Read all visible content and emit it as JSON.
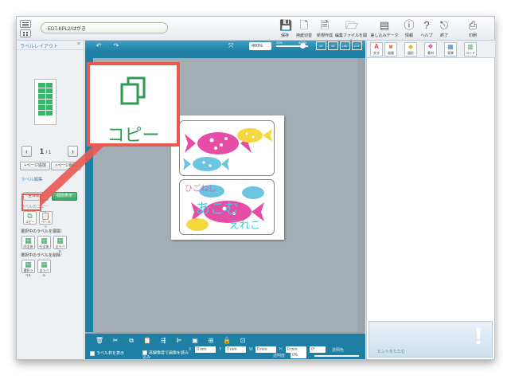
{
  "window": {
    "title": "EDT-KPL2/はがき"
  },
  "toolbar": [
    {
      "name": "save",
      "label": "保存",
      "icon": "save-icon"
    },
    {
      "name": "print-preview",
      "label": "用紙切替",
      "icon": "page-icon"
    },
    {
      "name": "new",
      "label": "新規作成",
      "icon": "new-file-icon"
    },
    {
      "name": "open",
      "label": "編集ファイルを開く",
      "icon": "folder-icon"
    },
    {
      "name": "data",
      "label": "差し込みデータ",
      "icon": "data-icon"
    },
    {
      "name": "info",
      "label": "情報",
      "icon": "info-icon"
    },
    {
      "name": "help",
      "label": "ヘルプ",
      "icon": "help-icon"
    },
    {
      "name": "exit",
      "label": "終了",
      "icon": "exit-icon"
    },
    {
      "name": "print",
      "label": "印刷",
      "icon": "print-icon"
    }
  ],
  "left_panel": {
    "title": "ラベルレイアウト",
    "close": "×",
    "page_current": "1",
    "page_total": "/ 1",
    "add_page": "+ページ追加",
    "delete_page": "×ページ削除",
    "label_edit_heading": "ラベル編集",
    "show_all": "全体表示",
    "individual": "個別表示",
    "copy_paste_heading": "ラベルのコピー",
    "copy": "コピー",
    "paste": "ペースト",
    "copy_selected_heading": "選択中のラベルを展開：",
    "expand_buttons": [
      "同全体",
      "行全体",
      "全ラベル"
    ],
    "delete_selected_heading": "選択中のラベルを削除：",
    "delete_buttons": [
      "選択ラベル",
      "全ラベル"
    ]
  },
  "canvas": {
    "zoom_label": "400%",
    "zoom_min": "25%",
    "zoom_max": "400%",
    "rotate_buttons": [
      "90°",
      "90°",
      "180°",
      "270°"
    ],
    "label_text_top": "ひごねし",
    "label_text_bottom": "えれこ",
    "label_text_main": "あこむ"
  },
  "bottom_bar": {
    "x_label": "X",
    "x_value": "0 mm",
    "y_label": "Y",
    "y_value": "0 mm",
    "w_label": "W",
    "w_value": "0 mm",
    "h_label": "H",
    "h_value": "0 mm",
    "angle_value": "0°",
    "transparency_label": "透明色",
    "opacity_label": "透明度",
    "opacity_value": "0%",
    "show_frame": "ラベル枠を表示",
    "hi_res": "高解像度で画像を読み込み"
  },
  "right_panel": {
    "tabs": [
      {
        "label": "文字",
        "glyph": "A",
        "color": "#d9443c"
      },
      {
        "label": "画像",
        "glyph": "■",
        "color": "#e87a2f"
      },
      {
        "label": "図形",
        "glyph": "◆",
        "color": "#e8b42f"
      },
      {
        "label": "素材",
        "glyph": "❖",
        "color": "#c23fa0"
      },
      {
        "label": "背景",
        "glyph": "▦",
        "color": "#3f7fc2"
      },
      {
        "label": "コード",
        "glyph": "▥",
        "color": "#2f9a56"
      }
    ],
    "hint_toggle": "ヒントをたたむ"
  },
  "callout": {
    "label": "コピー"
  }
}
